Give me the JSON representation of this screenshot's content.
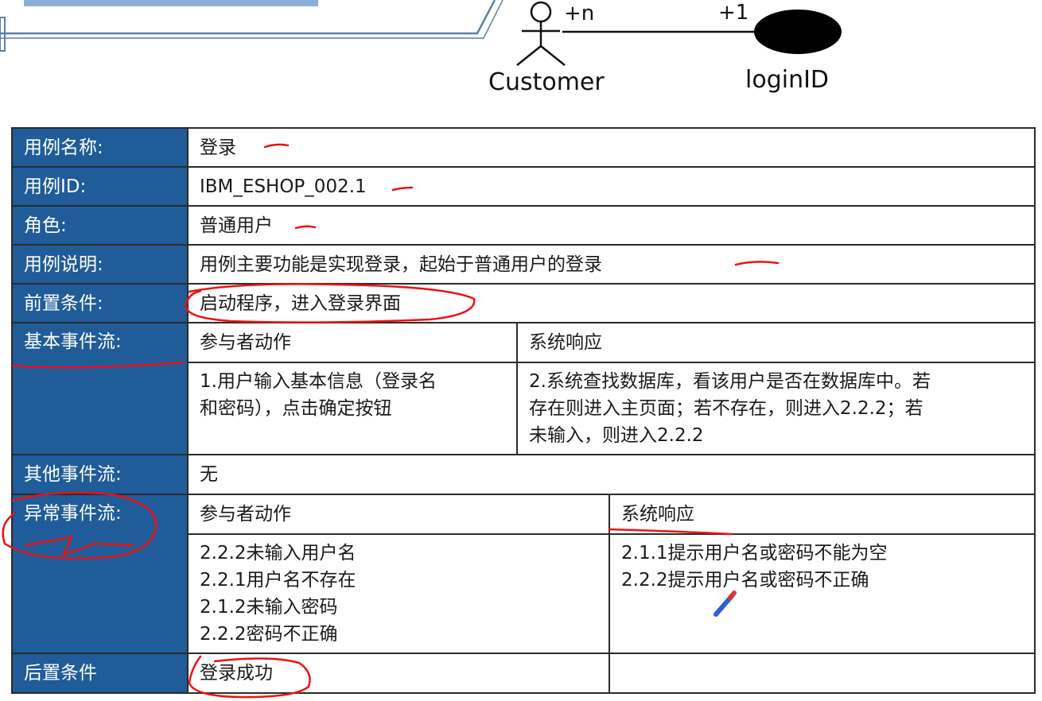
{
  "diagram": {
    "actor_label": "Customer",
    "entity_label": "loginID",
    "actor_multiplicity": "+n",
    "entity_multiplicity": "+1"
  },
  "rows": {
    "name": {
      "label": "用例名称:",
      "value": "登录"
    },
    "id": {
      "label": "用例ID:",
      "value": "IBM_ESHOP_002.1"
    },
    "role": {
      "label": "角色:",
      "value": "普通用户"
    },
    "desc": {
      "label": "用例说明:",
      "value": "用例主要功能是实现登录，起始于普通用户的登录"
    },
    "pre": {
      "label": "前置条件:",
      "value": "启动程序，进入登录界面"
    },
    "basic": {
      "label": "基本事件流:",
      "col1": "参与者动作",
      "col2": "系统响应",
      "actor_lines": [
        "1.用户输入基本信息（登录名",
        "和密码），点击确定按钮"
      ],
      "system_lines": [
        "2.系统查找数据库，看该用户是否在数据库中。若",
        "存在则进入主页面；若不存在，则进入2.2.2；若",
        "未输入，则进入2.2.2"
      ]
    },
    "other": {
      "label": "其他事件流:",
      "value": "无"
    },
    "exc": {
      "label": "异常事件流:",
      "col1": "参与者动作",
      "col2": "系统响应",
      "actor_lines": [
        "2.2.2未输入用户名",
        "2.2.1用户名不存在",
        "2.1.2未输入密码",
        "2.2.2密码不正确"
      ],
      "system_lines": [
        "2.1.1提示用户名或密码不能为空",
        "2.2.2提示用户名或密码不正确"
      ]
    },
    "post": {
      "label": "后置条件",
      "value": "登录成功"
    }
  },
  "colors": {
    "label_bg": "#1f5c99",
    "annotation": "#ee1111",
    "title_frame": "#5b7fae"
  }
}
